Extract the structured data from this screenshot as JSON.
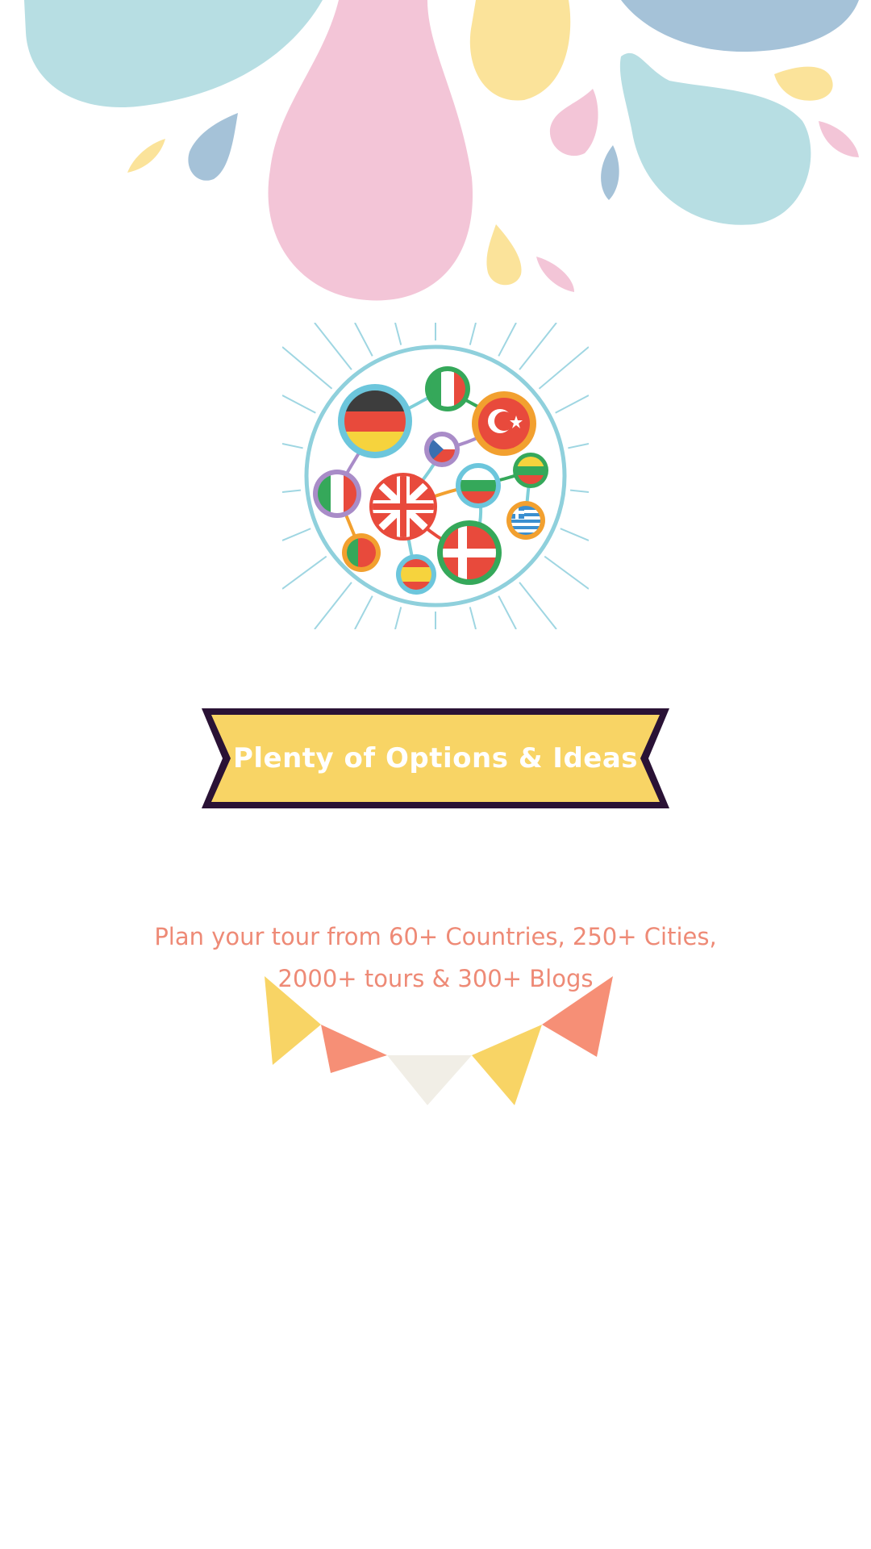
{
  "banner": {
    "title": "Plenty of Options & Ideas",
    "fill_color": "#f8d465",
    "outline_color": "#2a1235"
  },
  "tagline": {
    "line1": "Plan your tour from 60+ Countries, 250+ Cities,",
    "line2": "2000+ tours & 300+ Blogs",
    "color": "#ee8a76"
  },
  "illustration": {
    "icon": "country-flags-network-icon",
    "flags": [
      "germany",
      "italy",
      "turkey",
      "czech-republic",
      "united-kingdom",
      "bulgaria",
      "lithuania",
      "greece",
      "denmark",
      "spain",
      "portugal",
      "ireland"
    ]
  },
  "decorations": {
    "splash_colors": [
      "#b7dee3",
      "#f3c5d7",
      "#fbe39a",
      "#a5c2d8"
    ],
    "bunting_colors": [
      "#f8d465",
      "#f68f76",
      "#f1eee6"
    ]
  }
}
